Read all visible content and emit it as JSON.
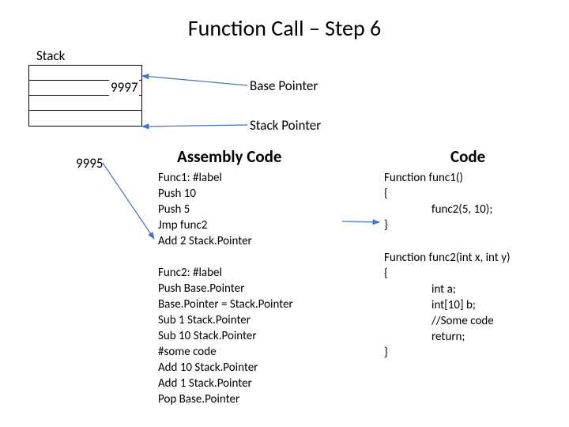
{
  "title": "Function Call – Step 6",
  "stack": {
    "label": "Stack"
  },
  "labels": {
    "basePointer": "Base Pointer",
    "stackPointer": "Stack Pointer",
    "v9997": "9997",
    "v9995": "9995",
    "asmHead": "Assembly Code",
    "codeHead": "Code"
  },
  "asm1": {
    "l1": "Func1: #label",
    "l2": "Push 10",
    "l3": "Push 5",
    "l4": "Jmp func2",
    "l5": "Add 2 Stack.Pointer"
  },
  "asm2": {
    "l1": "Func2: #label",
    "l2": "Push Base.Pointer",
    "l3": "Base.Pointer = Stack.Pointer",
    "l4": "Sub 1 Stack.Pointer",
    "l5": "Sub 10 Stack.Pointer",
    "l6": "#some code",
    "l7": "Add 10 Stack.Pointer",
    "l8": "Add 1 Stack.Pointer",
    "l9": "Pop Base.Pointer"
  },
  "code1": {
    "l1": "Function func1()",
    "l2": "{",
    "l3": "func2(5, 10);",
    "l4": "}"
  },
  "code2": {
    "l1": "Function func2(int x, int y)",
    "l2": "{",
    "l3": "int a;",
    "l4": "int[10] b;",
    "l5": "//Some code",
    "l6": "return;",
    "l7": "}"
  }
}
